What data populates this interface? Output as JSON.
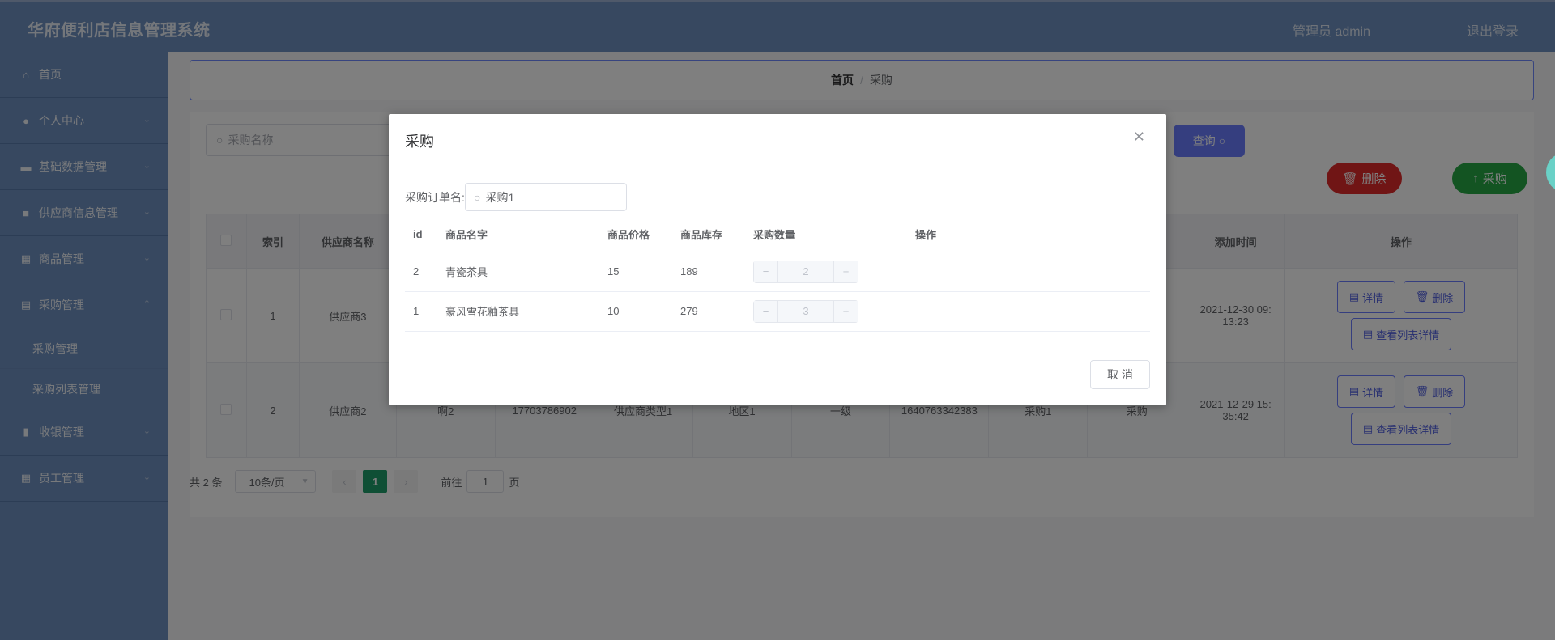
{
  "header": {
    "title": "华府便利店信息管理系统",
    "user": "管理员 admin",
    "logout": "退出登录"
  },
  "sidebar": {
    "items": [
      {
        "label": "首页",
        "icon": "home-icon"
      },
      {
        "label": "个人中心",
        "icon": "user-icon"
      },
      {
        "label": "基础数据管理",
        "icon": "chat-icon"
      },
      {
        "label": "供应商信息管理",
        "icon": "briefcase-icon"
      },
      {
        "label": "商品管理",
        "icon": "grid-icon"
      },
      {
        "label": "采购管理",
        "icon": "clipboard-icon"
      },
      {
        "label": "收银管理",
        "icon": "bar-chart-icon"
      },
      {
        "label": "员工管理",
        "icon": "table-icon"
      }
    ],
    "sub_items": [
      "采购管理",
      "采购列表管理"
    ]
  },
  "breadcrumb": {
    "home": "首页",
    "current": "采购"
  },
  "search": {
    "placeholder": "采购名称"
  },
  "buttons": {
    "query": "查询",
    "delete": "删除",
    "purchase": "采购"
  },
  "table": {
    "headers": [
      "索引",
      "供应商名称",
      "",
      "",
      "",
      "",
      "",
      "",
      "",
      "",
      "添加时间",
      "操作"
    ],
    "rows": [
      {
        "index": "1",
        "supplier": "供应商3",
        "c3": "",
        "c4": "",
        "c5": "",
        "c6": "",
        "c7": "",
        "c8": "",
        "c9": "",
        "c10": "",
        "time1": "2021-12-30 09:",
        "time2": "13:23"
      },
      {
        "index": "2",
        "supplier": "供应商2",
        "c3": "啊2",
        "c4": "17703786902",
        "c5": "供应商类型1",
        "c6": "地区1",
        "c7": "一级",
        "c8": "1640763342383",
        "c9": "采购1",
        "c10": "采购",
        "time1": "2021-12-29 15:",
        "time2": "35:42"
      }
    ],
    "row_ops": {
      "detail": "详情",
      "delete": "删除",
      "list_detail": "查看列表详情"
    }
  },
  "pager": {
    "total": "共 2 条",
    "page_size": "10条/页",
    "current_page": "1",
    "goto_label": "前往",
    "goto_value": "1",
    "page_unit": "页"
  },
  "dialog": {
    "title": "采购",
    "field_label": "采购订单名:",
    "field_value": "采购1",
    "headers": [
      "id",
      "商品名字",
      "商品价格",
      "商品库存",
      "采购数量",
      "操作"
    ],
    "rows": [
      {
        "id": "2",
        "name": "青瓷茶具",
        "price": "15",
        "stock": "189",
        "qty": "2"
      },
      {
        "id": "1",
        "name": "豪风雪花釉茶具",
        "price": "10",
        "stock": "279",
        "qty": "3"
      }
    ],
    "cancel": "取 消"
  },
  "colors": {
    "sidebar": "#6f90c0",
    "primary": "#6b7dff",
    "danger": "#e02a2a",
    "success": "#27a844",
    "page_active": "#1e9e6a"
  }
}
